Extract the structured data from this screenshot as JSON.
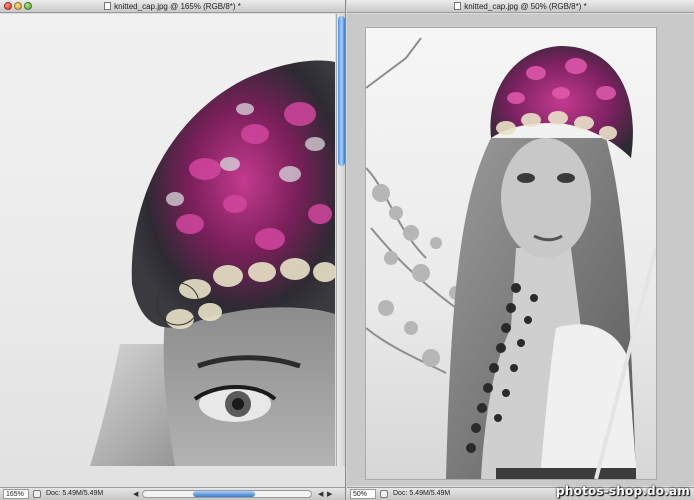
{
  "left_window": {
    "title": "knitted_cap.jpg @ 165% (RGB/8*) *",
    "zoom": "165%",
    "doc_info": "Doc: 5.49M/5.49M",
    "zoom_level": 165
  },
  "right_window": {
    "title": "knitted_cap.jpg @ 50% (RGB/8*) *",
    "zoom": "50%",
    "doc_info": "Doc: 5.49M/5.49M",
    "zoom_level": 50
  },
  "icons": {
    "close": "close-traffic-light",
    "minimize": "minimize-traffic-light",
    "maximize": "maximize-traffic-light"
  },
  "colors": {
    "accent_scroll": "#3a78c8",
    "cap_magenta": "#b0287d"
  },
  "watermark": "photos-shop.do.am"
}
